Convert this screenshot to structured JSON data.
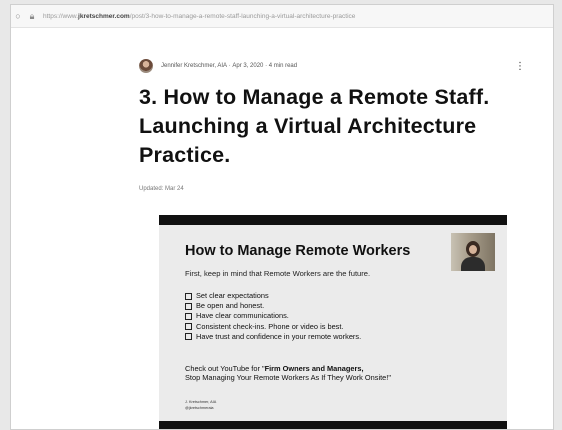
{
  "browser": {
    "url_prefix": "https://www.",
    "url_domain": "jkretschmer.com",
    "url_path": "/post/3-how-to-manage-a-remote-staff-launching-a-virtual-architecture-practice"
  },
  "post": {
    "author": "Jennifer Kretschmer, AIA",
    "date": "Apr 3, 2020",
    "read_time": "4 min read",
    "title": "3. How to Manage a Remote Staff. Launching a Virtual Architecture Practice.",
    "updated": "Updated: Mar 24"
  },
  "slide": {
    "title": "How to Manage Remote Workers",
    "subtitle": "First, keep in mind that Remote Workers are the future.",
    "checklist": [
      "Set clear expectations",
      "Be open and honest.",
      "Have clear communications.",
      "Consistent check-ins. Phone or video is best.",
      "Have trust and confidence in your remote workers."
    ],
    "promo_prefix": "Check out YouTube for \"",
    "promo_bold": "Firm Owners and Managers,",
    "promo_line2": "Stop Managing Your Remote Workers As If They Work Onsite!\"",
    "signature_name": "J. Kretschmer, AIA",
    "signature_handle": "@jkretschmeraia"
  }
}
